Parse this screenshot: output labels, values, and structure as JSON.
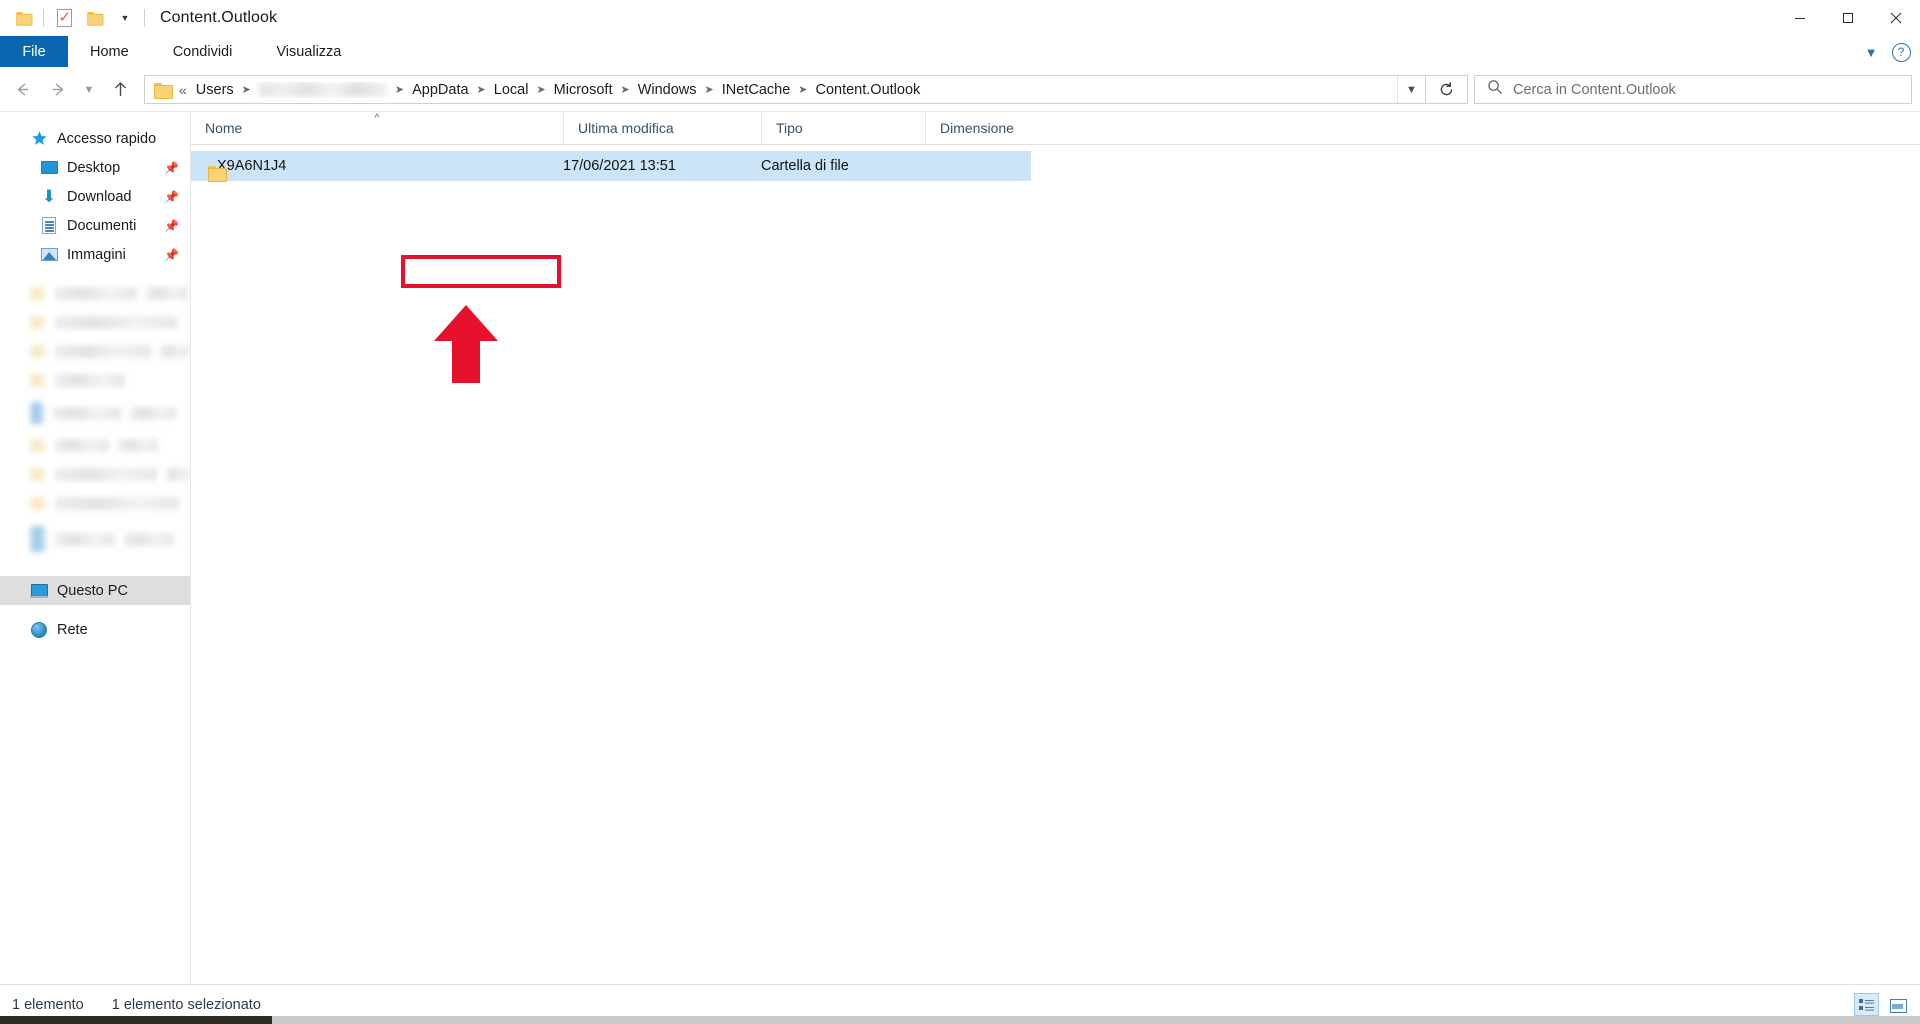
{
  "window": {
    "title": "Content.Outlook",
    "quick_access": [
      {
        "name": "folder-icon",
        "label": "Cartella"
      },
      {
        "name": "properties-icon",
        "label": "Proprietà"
      },
      {
        "name": "new-folder-icon",
        "label": "Nuova cartella"
      },
      {
        "name": "customize-caret-icon",
        "label": "Personalizza barra di accesso rapido"
      }
    ],
    "controls": {
      "minimize": "Riduci a icona",
      "maximize": "Ripristina",
      "close": "Chiudi"
    }
  },
  "ribbon": {
    "file_tab": "File",
    "tabs": [
      "Home",
      "Condividi",
      "Visualizza"
    ],
    "collapse_label": "Riduci barra multifunzione",
    "help_label": "?"
  },
  "nav": {
    "back": "Indietro",
    "forward": "Avanti",
    "recent": "Percorsi recenti",
    "up": "Su",
    "refresh_label": "Aggiorna",
    "address_caret": "Percorsi precedenti",
    "breadcrumb": {
      "prefix": "«",
      "items": [
        {
          "label": "Users",
          "blurred": false
        },
        {
          "label": "",
          "blurred": true
        },
        {
          "label": "AppData",
          "blurred": false
        },
        {
          "label": "Local",
          "blurred": false
        },
        {
          "label": "Microsoft",
          "blurred": false
        },
        {
          "label": "Windows",
          "blurred": false
        },
        {
          "label": "INetCache",
          "blurred": false
        },
        {
          "label": "Content.Outlook",
          "blurred": false
        }
      ]
    }
  },
  "search": {
    "placeholder": "Cerca in Content.Outlook",
    "value": ""
  },
  "sidebar": {
    "items": [
      {
        "label": "Accesso rapido",
        "icon": "star-icon",
        "pinned": false,
        "indent": false,
        "selected": false
      },
      {
        "label": "Desktop",
        "icon": "desktop-icon",
        "pinned": true,
        "indent": true,
        "selected": false
      },
      {
        "label": "Download",
        "icon": "download-icon",
        "pinned": true,
        "indent": true,
        "selected": false
      },
      {
        "label": "Documenti",
        "icon": "documents-icon",
        "pinned": true,
        "indent": true,
        "selected": false
      },
      {
        "label": "Immagini",
        "icon": "pictures-icon",
        "pinned": true,
        "indent": true,
        "selected": false
      }
    ],
    "blurred_rows": 11,
    "bottom_items": [
      {
        "label": "Questo PC",
        "icon": "this-pc-icon",
        "selected": true
      },
      {
        "label": "Rete",
        "icon": "network-icon",
        "selected": false
      }
    ]
  },
  "columns": [
    {
      "label": "Nome",
      "sorted": "asc"
    },
    {
      "label": "Ultima modifica",
      "sorted": ""
    },
    {
      "label": "Tipo",
      "sorted": ""
    },
    {
      "label": "Dimensione",
      "sorted": ""
    }
  ],
  "rows": [
    {
      "name": "X9A6N1J4",
      "modified": "17/06/2021 13:51",
      "type": "Cartella di file",
      "size": "",
      "icon": "folder-icon",
      "selected": true,
      "highlighted": true
    }
  ],
  "annotations": {
    "highlight_color": "#e8112d",
    "arrow_color": "#e8112d",
    "target_label": "X9A6N1J4"
  },
  "status": {
    "item_count": "1 elemento",
    "selection": "1 elemento selezionato"
  },
  "view_buttons": [
    {
      "name": "details-view-button",
      "label": "Dettagli",
      "active": true
    },
    {
      "name": "large-icons-view-button",
      "label": "Icone grandi",
      "active": false
    }
  ]
}
